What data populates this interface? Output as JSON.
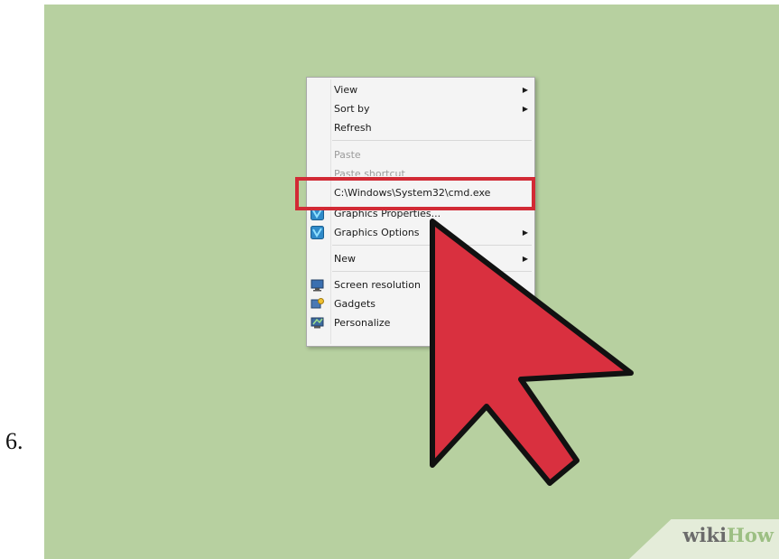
{
  "step": {
    "number": "6."
  },
  "context_menu": {
    "items": [
      {
        "label": "View",
        "submenu": true,
        "disabled": false,
        "icon": null
      },
      {
        "label": "Sort by",
        "submenu": true,
        "disabled": false,
        "icon": null
      },
      {
        "label": "Refresh",
        "submenu": false,
        "disabled": false,
        "icon": null
      },
      {
        "label": "Paste",
        "submenu": false,
        "disabled": true,
        "icon": null
      },
      {
        "label": "Paste shortcut",
        "submenu": false,
        "disabled": true,
        "icon": null
      },
      {
        "label": "C:\\Windows\\System32\\cmd.exe",
        "submenu": false,
        "disabled": false,
        "highlighted": true,
        "icon": null
      },
      {
        "label": "Graphics Properties...",
        "submenu": false,
        "disabled": false,
        "icon": "graphics-icon"
      },
      {
        "label": "Graphics Options",
        "submenu": true,
        "disabled": false,
        "icon": "graphics-icon"
      },
      {
        "label": "New",
        "submenu": true,
        "disabled": false,
        "icon": null
      },
      {
        "label": "Screen resolution",
        "submenu": false,
        "disabled": false,
        "icon": "display-icon"
      },
      {
        "label": "Gadgets",
        "submenu": false,
        "disabled": false,
        "icon": "gadgets-icon"
      },
      {
        "label": "Personalize",
        "submenu": false,
        "disabled": false,
        "icon": "personalize-icon"
      }
    ],
    "arrow_glyph": "▶"
  },
  "watermark": {
    "part1": "wiki",
    "part2": "How"
  },
  "colors": {
    "desktop_bg": "#b7d0a0",
    "highlight": "#d22a35",
    "cursor_fill": "#d9303f",
    "cursor_stroke": "#111111"
  }
}
